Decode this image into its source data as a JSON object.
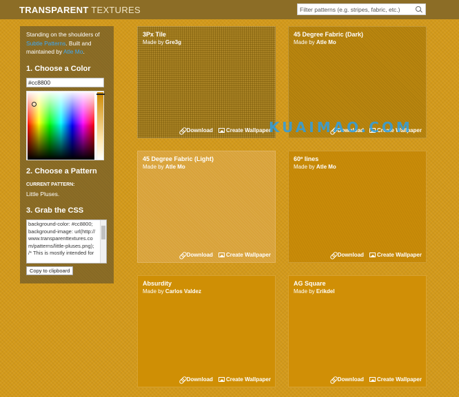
{
  "header": {
    "logo_bold": "TRANSPARENT",
    "logo_light": "TEXTURES",
    "search_placeholder": "Filter patterns (e.g. stripes, fabric, etc.)",
    "search_icon": "search-icon"
  },
  "sidebar": {
    "intro_prefix": "Standing on the shoulders of",
    "intro_link1": "Subtle Patterns",
    "intro_mid": ". Built and maintained by",
    "intro_link2": "Atle Mo",
    "intro_suffix": ".",
    "choose_color_heading": "1. Choose a Color",
    "color_value": "#cc8800",
    "choose_pattern_heading": "2. Choose a Pattern",
    "current_pattern_label": "CURRENT PATTERN:",
    "current_pattern_value": "Little Pluses.",
    "grab_css_heading": "3. Grab the CSS",
    "css_code": "background-color: #cc8800;\nbackground-image: url(http://www.transparenttextures.com/patterns/little-pluses.png);\n/* This is mostly intended for",
    "copy_button": "Copy to clipboard"
  },
  "cards": [
    {
      "title": "3Px Tile",
      "made_by": "Made by",
      "author": "Gre3g",
      "download": "Download",
      "wallpaper": "Create Wallpaper"
    },
    {
      "title": "45 Degree Fabric (Dark)",
      "made_by": "Made by",
      "author": "Atle Mo",
      "download": "Download",
      "wallpaper": "Create Wallpaper"
    },
    {
      "title": "45 Degree Fabric (Light)",
      "made_by": "Made by",
      "author": "Atle Mo",
      "download": "Download",
      "wallpaper": "Create Wallpaper"
    },
    {
      "title": "60º lines",
      "made_by": "Made by",
      "author": "Atle Mo",
      "download": "Download",
      "wallpaper": "Create Wallpaper"
    },
    {
      "title": "Absurdity",
      "made_by": "Made by",
      "author": "Carlos Valdez",
      "download": "Download",
      "wallpaper": "Create Wallpaper"
    },
    {
      "title": "AG Square",
      "made_by": "Made by",
      "author": "Erikdel",
      "download": "Download",
      "wallpaper": "Create Wallpaper"
    }
  ],
  "watermark": "KUAIMAO.COM",
  "colors": {
    "accent": "#cc8800",
    "header_bg": "#8c6d26",
    "link": "#3fa9f5"
  }
}
